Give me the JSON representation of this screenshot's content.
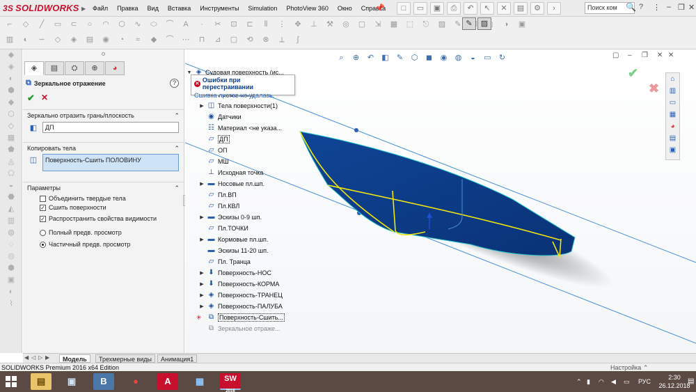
{
  "app": {
    "logo_text": "SOLIDWORKS",
    "logo_prefix": "3S",
    "search_placeholder": "Поиск ком",
    "help": "?"
  },
  "menu": [
    "Файл",
    "Правка",
    "Вид",
    "Вставка",
    "Инструменты",
    "Simulation",
    "PhotoView 360",
    "Окно",
    "Справка"
  ],
  "property_manager": {
    "title": "Зеркальное отражение",
    "help_label": "?",
    "section_mirror": "Зеркально отразить грань/плоскость",
    "mirror_plane_value": "ДП",
    "section_bodies": "Копировать тела",
    "bodies_value": "Поверхность-Сшить ПОЛОВИНУ",
    "section_params": "Параметры",
    "options": [
      {
        "label": "Объединить твердые тела",
        "checked": false
      },
      {
        "label": "Сшить поверхности",
        "checked": true
      },
      {
        "label": "Распространить свойства видимости",
        "checked": true
      }
    ],
    "preview_options": [
      {
        "label": "Полный предв. просмотр",
        "selected": false
      },
      {
        "label": "Частичный предв. просмотр",
        "selected": true
      }
    ]
  },
  "feature_tree": {
    "root": "Судовая поверхность (ис...",
    "tooltip_title": "Ошибки при перестраивании",
    "tooltip_message": "Сшивка листов не удалась.",
    "items": [
      {
        "label": "Примечания",
        "icon": "annotations-icon"
      },
      {
        "label": "Тела поверхности(1)",
        "icon": "surface-bodies-icon"
      },
      {
        "label": "Датчики",
        "icon": "sensors-icon"
      },
      {
        "label": "Материал <не указа...",
        "icon": "material-icon"
      },
      {
        "label": "ДП",
        "icon": "plane-icon"
      },
      {
        "label": "ОП",
        "icon": "plane-icon"
      },
      {
        "label": "МШ",
        "icon": "plane-icon"
      },
      {
        "label": "Исходная точка",
        "icon": "origin-icon"
      },
      {
        "label": "Носовые пл.шп.",
        "icon": "folder-icon"
      },
      {
        "label": "Пл.ВП",
        "icon": "plane-icon"
      },
      {
        "label": "Пл.КВЛ",
        "icon": "plane-icon"
      },
      {
        "label": "Эскизы 0-9 шп.",
        "icon": "folder-icon"
      },
      {
        "label": "Пл.ТОЧКИ",
        "icon": "plane-icon"
      },
      {
        "label": "Кормовые пл.шп.",
        "icon": "folder-icon"
      },
      {
        "label": "Эскизы 11-20 шп.",
        "icon": "folder-icon"
      },
      {
        "label": "Пл. Транца",
        "icon": "plane-icon"
      },
      {
        "label": "Поверхность-НОС",
        "icon": "loft-surface-icon"
      },
      {
        "label": "Поверхность-КОРМА",
        "icon": "loft-surface-icon"
      },
      {
        "label": "Поверхность-ТРАНЕЦ",
        "icon": "surface-icon"
      },
      {
        "label": "Поверхность-ПАЛУБА",
        "icon": "surface-icon"
      },
      {
        "label": "Поверхность-Сшить...",
        "icon": "knit-surface-icon"
      },
      {
        "label": "Зеркальное отраже...",
        "icon": "mirror-icon"
      }
    ]
  },
  "bottom_tabs": [
    "Модель",
    "Трехмерные виды",
    "Анимация1"
  ],
  "status": {
    "edition": "SOLIDWORKS Premium 2016 x64 Edition",
    "custom": "Настройка"
  },
  "taskbar": {
    "apps": [
      {
        "name": "explorer",
        "glyph": "▤"
      },
      {
        "name": "network",
        "glyph": "▣"
      },
      {
        "name": "vk",
        "glyph": "B"
      },
      {
        "name": "chrome",
        "glyph": "●"
      },
      {
        "name": "acrobat",
        "glyph": "A"
      },
      {
        "name": "photos",
        "glyph": "▦"
      },
      {
        "name": "solidworks",
        "glyph": "SW"
      }
    ],
    "solidworks_version": "2016",
    "lang": "РУС",
    "time": "2:30",
    "date": "26.12.2018"
  },
  "colors": {
    "hull": "#0c3b86",
    "edge_yellow": "#f2e60f",
    "plane_line": "#4a90d9",
    "accent_red": "#c8102e"
  }
}
